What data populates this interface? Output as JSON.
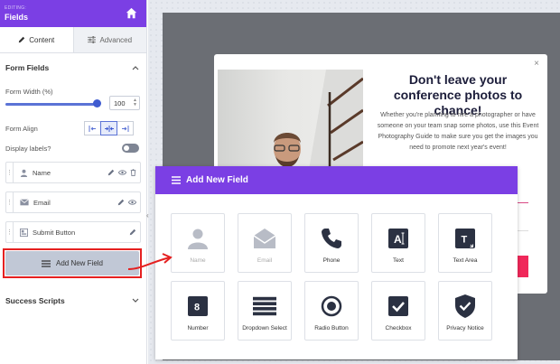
{
  "sidebar": {
    "editing_label": "EDITING:",
    "title": "Fields",
    "tabs": [
      {
        "label": "Content",
        "icon": "pencil-icon"
      },
      {
        "label": "Advanced",
        "icon": "sliders-icon"
      }
    ],
    "form_fields_title": "Form Fields",
    "form_width_label": "Form Width (%)",
    "form_width_value": "100",
    "form_width_percent": 100,
    "form_align_label": "Form Align",
    "display_labels_label": "Display labels?",
    "display_labels_on": false,
    "fields": [
      {
        "label": "Name",
        "icon": "user-icon"
      },
      {
        "label": "Email",
        "icon": "envelope-icon"
      },
      {
        "label": "Submit Button",
        "icon": "button-icon"
      }
    ],
    "add_field_label": "Add New Field",
    "success_scripts_title": "Success Scripts"
  },
  "popup": {
    "title": "Don't leave your conference photos to chance!",
    "body": "Whether you're planning to hire a photographer or have someone on your team snap some photos, use this Event Photography Guide to make sure you get the images you need to promote next year's event!",
    "close": "×"
  },
  "modal": {
    "title": "Add New Field",
    "tiles": [
      {
        "label": "Name",
        "icon": "person-icon",
        "disabled": true
      },
      {
        "label": "Email",
        "icon": "envelope-icon",
        "disabled": true
      },
      {
        "label": "Phone",
        "icon": "phone-icon",
        "disabled": false
      },
      {
        "label": "Text",
        "icon": "text-icon",
        "disabled": false
      },
      {
        "label": "Text Area",
        "icon": "textarea-icon",
        "disabled": false
      },
      {
        "label": "Number",
        "icon": "number-icon",
        "disabled": false
      },
      {
        "label": "Dropdown Select",
        "icon": "dropdown-icon",
        "disabled": false
      },
      {
        "label": "Radio Button",
        "icon": "radio-icon",
        "disabled": false
      },
      {
        "label": "Checkbox",
        "icon": "checkbox-icon",
        "disabled": false
      },
      {
        "label": "Privacy Notice",
        "icon": "shield-check-icon",
        "disabled": false
      }
    ],
    "number_glyph": "8",
    "text_glyph": "A",
    "textarea_glyph": "T"
  },
  "colors": {
    "brand_purple": "#7b3fe4",
    "highlight_red": "#e52020",
    "icon_dark": "#2b3142",
    "icon_disabled": "#b8bcc6"
  }
}
